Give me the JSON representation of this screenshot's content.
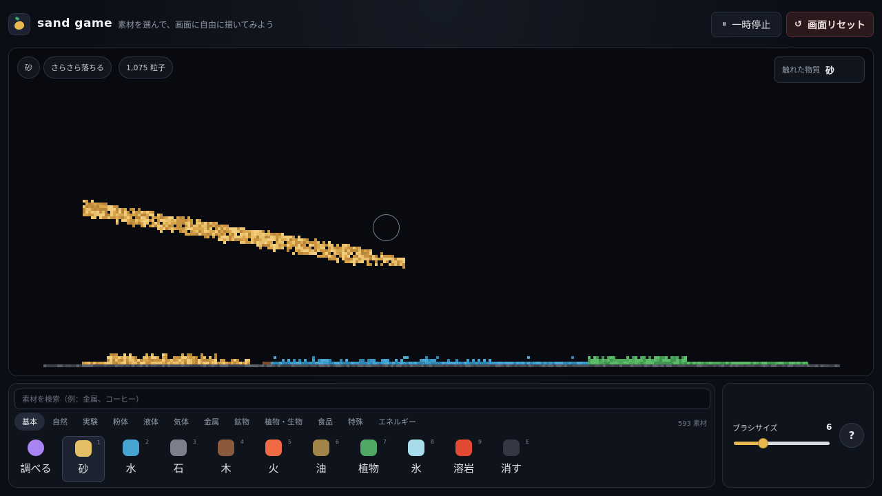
{
  "header": {
    "title": "sand game",
    "subtitle": "素材を選んで、画面に自由に描いてみよう",
    "pause_label": "一時停止",
    "reset_label": "画面リセット"
  },
  "status": {
    "material": "砂",
    "behavior": "さらさら落ちる",
    "particles": "1,075 粒子"
  },
  "touched": {
    "label": "触れた物質",
    "value": "砂"
  },
  "search": {
    "placeholder": "素材を検索（例：金属、コーヒー）"
  },
  "categories": [
    "基本",
    "自然",
    "実験",
    "粉体",
    "液体",
    "気体",
    "金属",
    "鉱物",
    "植物・生物",
    "食品",
    "特殊",
    "エネルギー"
  ],
  "active_category": "基本",
  "material_count": "593 素材",
  "tools": [
    {
      "label": "調べる",
      "key": "",
      "color": "#a784f2"
    },
    {
      "label": "砂",
      "key": "1",
      "color": "#e5bf63"
    },
    {
      "label": "水",
      "key": "2",
      "color": "#47a4d0"
    },
    {
      "label": "石",
      "key": "3",
      "color": "#7c808c"
    },
    {
      "label": "木",
      "key": "4",
      "color": "#8b5a3c"
    },
    {
      "label": "火",
      "key": "5",
      "color": "#ef6a45"
    },
    {
      "label": "油",
      "key": "6",
      "color": "#a08448"
    },
    {
      "label": "植物",
      "key": "7",
      "color": "#4fa863"
    },
    {
      "label": "氷",
      "key": "8",
      "color": "#a8dceb"
    },
    {
      "label": "溶岩",
      "key": "9",
      "color": "#e24a33"
    },
    {
      "label": "消す",
      "key": "E",
      "color": "#343845"
    }
  ],
  "active_tool": "砂",
  "brush": {
    "label": "ブラシサイズ",
    "value": "6",
    "fraction": 0.3
  },
  "help_label": "?",
  "colors": {
    "sand": [
      "#e8c06a",
      "#d9a64a",
      "#c99340",
      "#f0cc7c",
      "#b8863a"
    ],
    "water": [
      "#3a9cc8",
      "#2f86b0",
      "#4aa8d4"
    ],
    "stone": [
      "#4a4e58",
      "#5d616b",
      "#3c4049"
    ],
    "plant": [
      "#4caa5a",
      "#3f9650",
      "#5cbb68"
    ],
    "wood": [
      "#7a4c32"
    ]
  }
}
